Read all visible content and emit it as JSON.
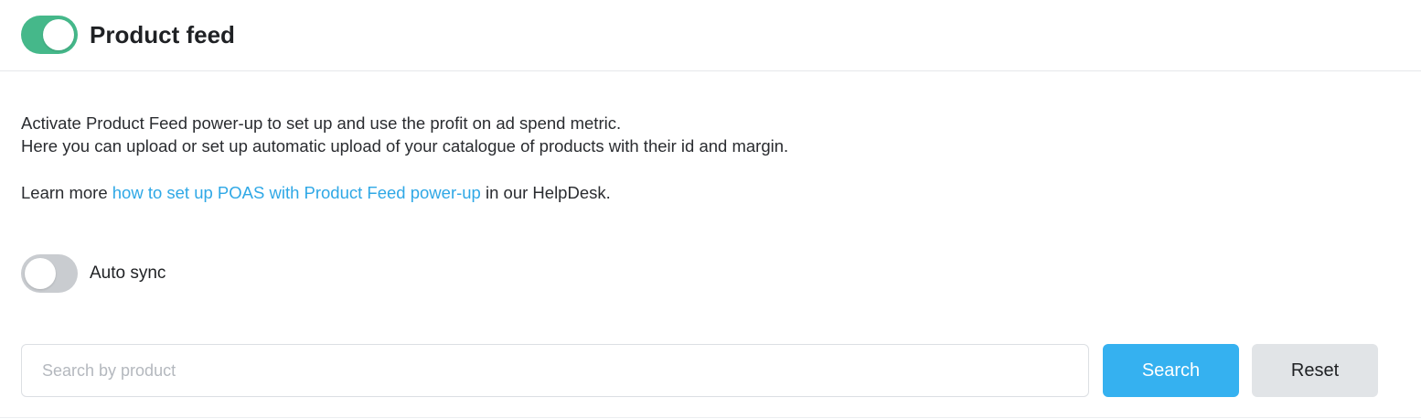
{
  "header": {
    "title": "Product feed",
    "enabled": true
  },
  "description": {
    "line1": "Activate Product Feed power-up to set up and use the profit on ad spend metric.",
    "line2": "Here you can upload or set up automatic upload of your catalogue of products with their id and margin."
  },
  "learn_more": {
    "prefix": "Learn more ",
    "link_text": "how to set up POAS with Product Feed power-up",
    "suffix": " in our HelpDesk."
  },
  "auto_sync": {
    "label": "Auto sync",
    "enabled": false
  },
  "search": {
    "placeholder": "Search by product",
    "value": "",
    "search_label": "Search",
    "reset_label": "Reset"
  },
  "colors": {
    "toggle_on": "#45b88a",
    "toggle_off": "#c9ccd0",
    "link": "#2fa8e6",
    "primary_button": "#35b1f0",
    "secondary_button": "#e1e4e7"
  }
}
